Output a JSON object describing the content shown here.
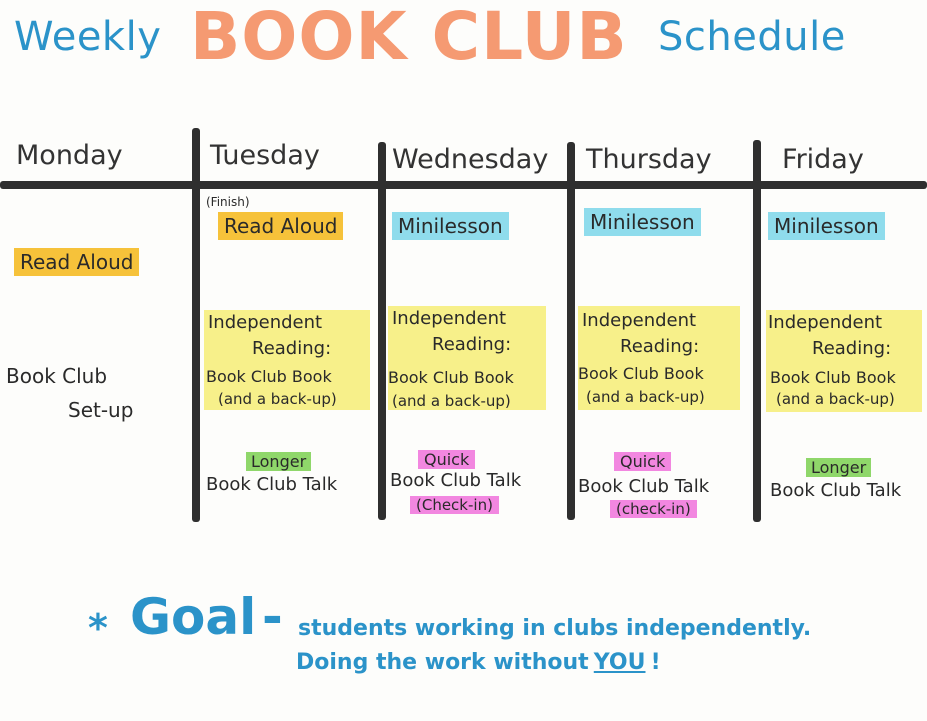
{
  "title": {
    "left": "Weekly",
    "center": "BOOK CLUB",
    "right": "Schedule"
  },
  "days": [
    "Monday",
    "Tuesday",
    "Wednesday",
    "Thursday",
    "Friday"
  ],
  "monday": {
    "read_aloud": "Read Aloud",
    "setup_line1": "Book Club",
    "setup_line2": "Set-up"
  },
  "tuesday": {
    "finish": "(Finish)",
    "read_aloud": "Read Aloud",
    "ind1": "Independent",
    "ind2": "Reading:",
    "ind3": "Book Club Book",
    "ind4": "(and a back-up)",
    "talk_tag": "Longer",
    "talk": "Book Club Talk"
  },
  "wednesday": {
    "mini": "Minilesson",
    "ind1": "Independent",
    "ind2": "Reading:",
    "ind3": "Book Club Book",
    "ind4": "(and a back-up)",
    "talk_tag": "Quick",
    "talk": "Book Club Talk",
    "checkin": "(Check-in)"
  },
  "thursday": {
    "mini": "Minilesson",
    "ind1": "Independent",
    "ind2": "Reading:",
    "ind3": "Book Club Book",
    "ind4": "(and a back-up)",
    "talk_tag": "Quick",
    "talk": "Book Club Talk",
    "checkin": "(check-in)"
  },
  "friday": {
    "mini": "Minilesson",
    "ind1": "Independent",
    "ind2": "Reading:",
    "ind3": "Book Club Book",
    "ind4": "(and a back-up)",
    "talk_tag": "Longer",
    "talk": "Book Club Talk"
  },
  "goal": {
    "star": "*",
    "word": "Goal",
    "dash": "-",
    "line1": "students working in clubs independently.",
    "line2_pre": "Doing the work without",
    "line2_you": "YOU",
    "line2_post": "!"
  },
  "colors": {
    "title_blue": "#2b93c9",
    "title_orange": "#f59a72",
    "highlight_orange": "#f6c23a",
    "highlight_blue": "#8fdcec",
    "highlight_yellow": "#f7f08a",
    "highlight_green": "#8fd76a",
    "highlight_pink": "#f287e0"
  }
}
